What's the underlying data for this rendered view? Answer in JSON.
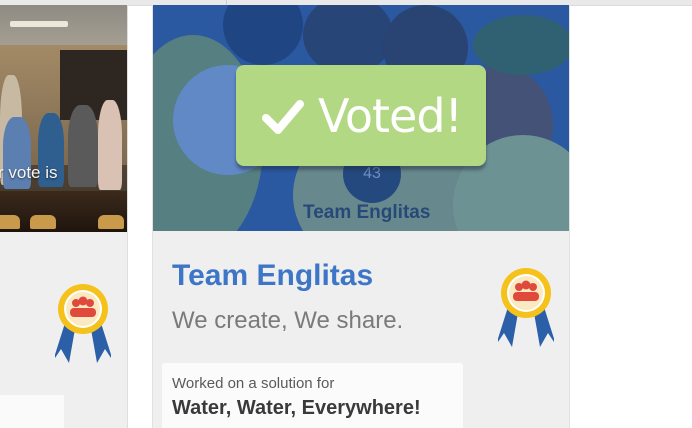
{
  "left_card": {
    "overlay_text": "r vote is",
    "award_icon": "award-ribbon-team-icon"
  },
  "main_card": {
    "voted_badge": {
      "label": "Voted!",
      "icon": "checkmark-icon",
      "color": "#b3d884"
    },
    "photo_shirt": {
      "number": "43",
      "text": "Team Englitas"
    },
    "team_name": "Team Englitas",
    "tagline": "We create, We share.",
    "award_icon": "award-ribbon-team-icon",
    "solution": {
      "lead": "Worked on a solution for",
      "title": "Water, Water, Everywhere!"
    }
  },
  "colors": {
    "accent_blue": "#3d76c6",
    "ribbon_gold": "#f5c21b",
    "ribbon_blue": "#2b5fa8",
    "team_red": "#e04a3c"
  }
}
